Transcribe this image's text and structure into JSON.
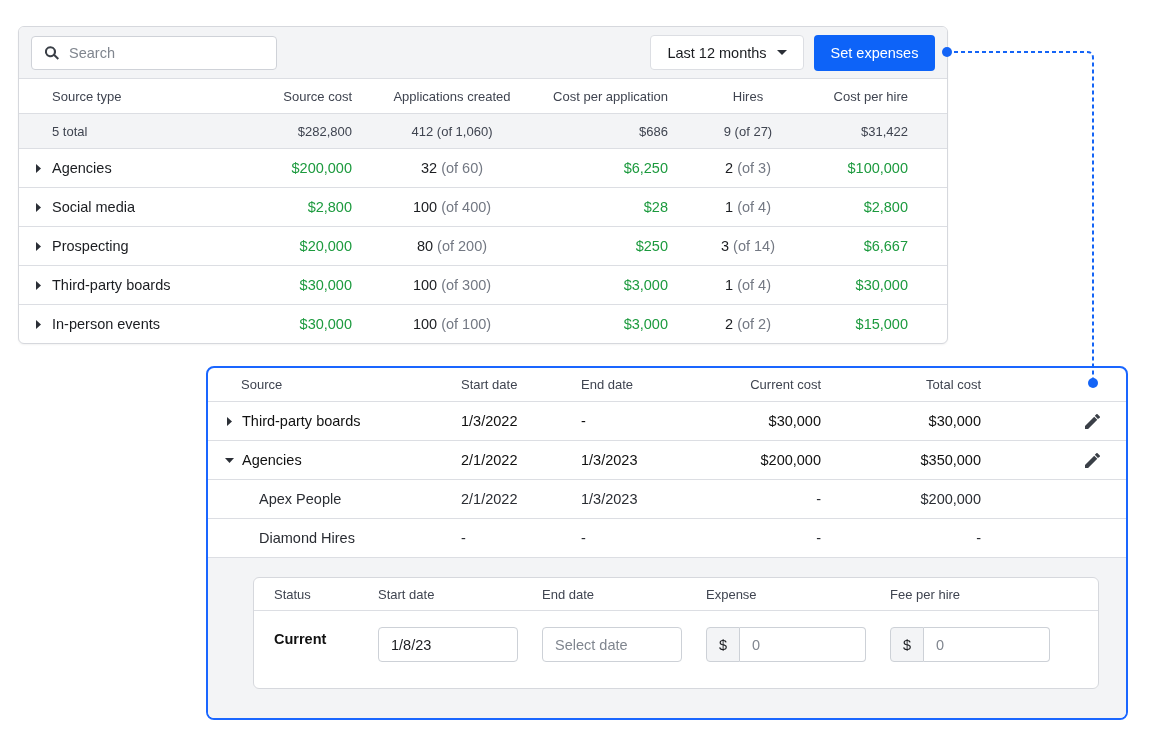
{
  "toolbar": {
    "search": {
      "placeholder": "Search"
    },
    "period": {
      "value": "Last 12 months"
    },
    "set_expenses": {
      "label": "Set expenses"
    }
  },
  "summary_table": {
    "columns": [
      "Source type",
      "Source cost",
      "Applications created",
      "Cost per application",
      "Hires",
      "Cost per hire"
    ],
    "total_row": [
      "5 total",
      "$282,800",
      "412 (of 1,060)",
      "$686",
      "9 (of 27)",
      "$31,422"
    ],
    "rows": [
      {
        "name": "Agencies",
        "expanded": false,
        "source_cost": "$200,000",
        "applications": "32",
        "applications_of": "(of 60)",
        "cost_per_application": "$6,250",
        "hires": "2",
        "hires_of": "(of 3)",
        "cost_per_hire": "$100,000"
      },
      {
        "name": "Social media",
        "expanded": false,
        "source_cost": "$2,800",
        "applications": "100",
        "applications_of": "(of 400)",
        "cost_per_application": "$28",
        "hires": "1",
        "hires_of": "(of 4)",
        "cost_per_hire": "$2,800"
      },
      {
        "name": "Prospecting",
        "expanded": false,
        "source_cost": "$20,000",
        "applications": "80",
        "applications_of": "(of 200)",
        "cost_per_application": "$250",
        "hires": "3",
        "hires_of": "(of 14)",
        "cost_per_hire": "$6,667"
      },
      {
        "name": "Third-party boards",
        "expanded": false,
        "source_cost": "$30,000",
        "applications": "100",
        "applications_of": "(of 300)",
        "cost_per_application": "$3,000",
        "hires": "1",
        "hires_of": "(of 4)",
        "cost_per_hire": "$30,000"
      },
      {
        "name": "In-person events",
        "expanded": false,
        "source_cost": "$30,000",
        "applications": "100",
        "applications_of": "(of 100)",
        "cost_per_application": "$3,000",
        "hires": "2",
        "hires_of": "(of 2)",
        "cost_per_hire": "$15,000"
      }
    ]
  },
  "source_editor": {
    "columns": [
      "Source",
      "Start date",
      "End date",
      "Current cost",
      "Total cost"
    ],
    "rows": [
      {
        "name": "Third-party boards",
        "expanded": false,
        "start_date": "1/3/2022",
        "end_date": "-",
        "current_cost": "$30,000",
        "total_cost": "$30,000"
      },
      {
        "name": "Agencies",
        "expanded": true,
        "start_date": "2/1/2022",
        "end_date": "1/3/2023",
        "current_cost": "$200,000",
        "total_cost": "$350,000",
        "children": [
          {
            "name": "Apex People",
            "start_date": "2/1/2022",
            "end_date": "1/3/2023",
            "current_cost": "-",
            "total_cost": "$200,000"
          },
          {
            "name": "Diamond Hires",
            "start_date": "-",
            "end_date": "-",
            "current_cost": "-",
            "total_cost": "-"
          }
        ]
      }
    ],
    "expense_form": {
      "columns": [
        "Status",
        "Start date",
        "End date",
        "Expense",
        "Fee per hire"
      ],
      "status": "Current",
      "start_date": {
        "value": "1/8/23"
      },
      "end_date": {
        "placeholder": "Select date"
      },
      "expense": {
        "prefix": "$",
        "placeholder": "0"
      },
      "fee_per_hire": {
        "prefix": "$",
        "placeholder": "0"
      }
    }
  }
}
